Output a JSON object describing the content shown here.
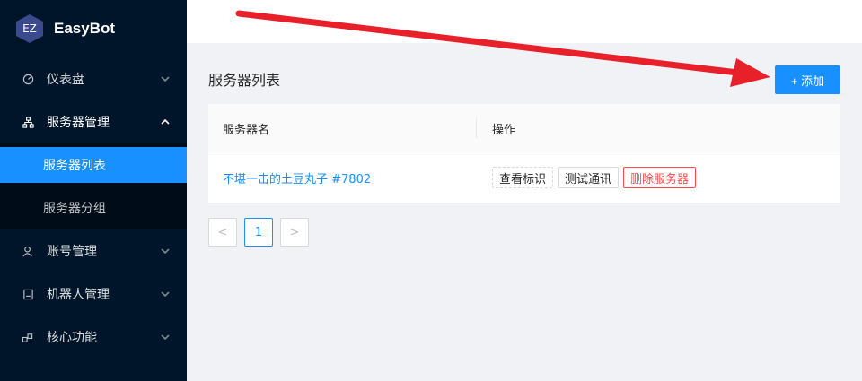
{
  "app": {
    "logo_mark": "EZ",
    "name": "EasyBot"
  },
  "sidebar": {
    "items": [
      {
        "label": "仪表盘",
        "icon": "dashboard-icon"
      },
      {
        "label": "服务器管理",
        "icon": "cluster-icon",
        "expanded": true,
        "children": [
          {
            "label": "服务器列表",
            "active": true
          },
          {
            "label": "服务器分组"
          }
        ]
      },
      {
        "label": "账号管理",
        "icon": "user-icon"
      },
      {
        "label": "机器人管理",
        "icon": "robot-icon"
      },
      {
        "label": "核心功能",
        "icon": "function-icon"
      }
    ]
  },
  "main": {
    "title": "服务器列表",
    "add_button": "+ 添加",
    "table": {
      "columns": [
        "服务器名",
        "操作"
      ],
      "rows": [
        {
          "name": "不堪一击的土豆丸子 #7802",
          "actions": [
            "查看标识",
            "测试通讯",
            "删除服务器"
          ]
        }
      ]
    },
    "pagination": {
      "prev": "<",
      "current": "1",
      "next": ">"
    }
  },
  "annotation": {
    "type": "arrow",
    "color": "#e8202a"
  },
  "colors": {
    "sidebar_bg": "#001529",
    "primary": "#1890ff",
    "danger": "#ff4d4f"
  }
}
